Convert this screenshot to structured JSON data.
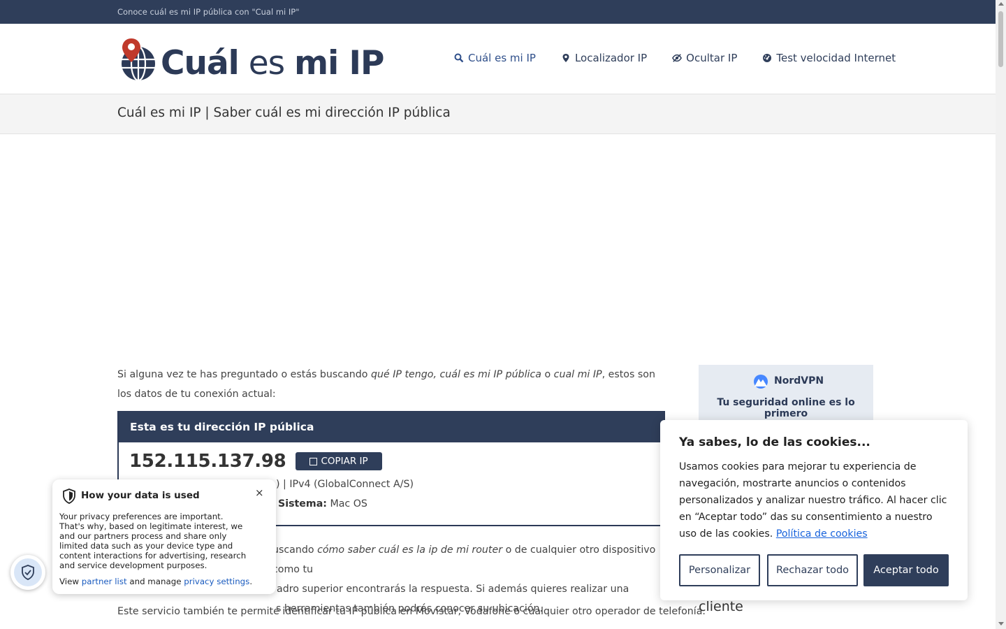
{
  "topbar": {
    "text": "Conoce cuál es mi IP pública con \"Cual mi IP\""
  },
  "logo": {
    "word1": "Cuál",
    "word2": "es",
    "word3": "mi IP"
  },
  "nav": {
    "items": [
      {
        "label": "Cuál es mi IP",
        "icon": "search-icon"
      },
      {
        "label": "Localizador IP",
        "icon": "map-pin-icon"
      },
      {
        "label": "Ocultar IP",
        "icon": "eye-slash-icon"
      },
      {
        "label": "Test velocidad Internet",
        "icon": "speedometer-icon"
      }
    ]
  },
  "page": {
    "title": "Cuál es mi IP | Saber cuál es mi dirección IP pública"
  },
  "intro": {
    "t1": "Si alguna vez te has preguntado o estás buscando ",
    "em1": "qué IP tengo, cuál es mi IP pública",
    "t2": " o ",
    "em2": "cual mi IP",
    "t3": ", estos son los datos de tu conexión actual:"
  },
  "ip_box": {
    "heading": "Esta es tu dirección IP pública",
    "ip": "152.115.137.98",
    "copy_label": "COPIAR IP",
    "info1": ") | IPv4 (GlobalConnect A/S)",
    "info2_label": "Sistema:",
    "info2_value": "Mac OS"
  },
  "body2": {
    "l1a": "uscando ",
    "l1em": "cómo saber cuál es la ip de mi router",
    "l1b": " o de cualquier otro dispositivo como tu",
    "l2": "adro superior encontrarás la respuesta. Si además quieres realizar una",
    "l3": "s herramientas también podrás conocer su ubicación."
  },
  "body3": "Este servicio también te permite identificar tu IP pública en Movistar, Vodafone o cualquier otro operador de telefonía.",
  "side_ad": {
    "brand": "NordVPN",
    "tagline": "Tu seguridad online es lo primero"
  },
  "side_text": "cliente",
  "cookie": {
    "title": "Ya sabes, lo de las cookies...",
    "text": "Usamos cookies para mejorar tu experiencia de navegación, mostrarte anuncios o contenidos personalizados y analizar nuestro tráfico. Al hacer clic en “Aceptar todo” das su consentimiento a nuestro uso de las cookies. ",
    "link": "Política de cookies",
    "btn_customize": "Personalizar",
    "btn_reject": "Rechazar todo",
    "btn_accept": "Aceptar todo"
  },
  "privacy": {
    "title": "How your data is used",
    "close": "×",
    "text": "Your privacy preferences are important. That's why, based on legitimate interest, we and our partners process and share only limited data such as your device type and content interactions for advertising, research and service development purposes.",
    "view": "View ",
    "partner_link": "partner list",
    "and_manage": " and manage ",
    "settings_link": "privacy settings",
    "period": "."
  },
  "colors": {
    "navy": "#2f3e5a",
    "link": "#1863dc",
    "pin": "#c0392b"
  }
}
